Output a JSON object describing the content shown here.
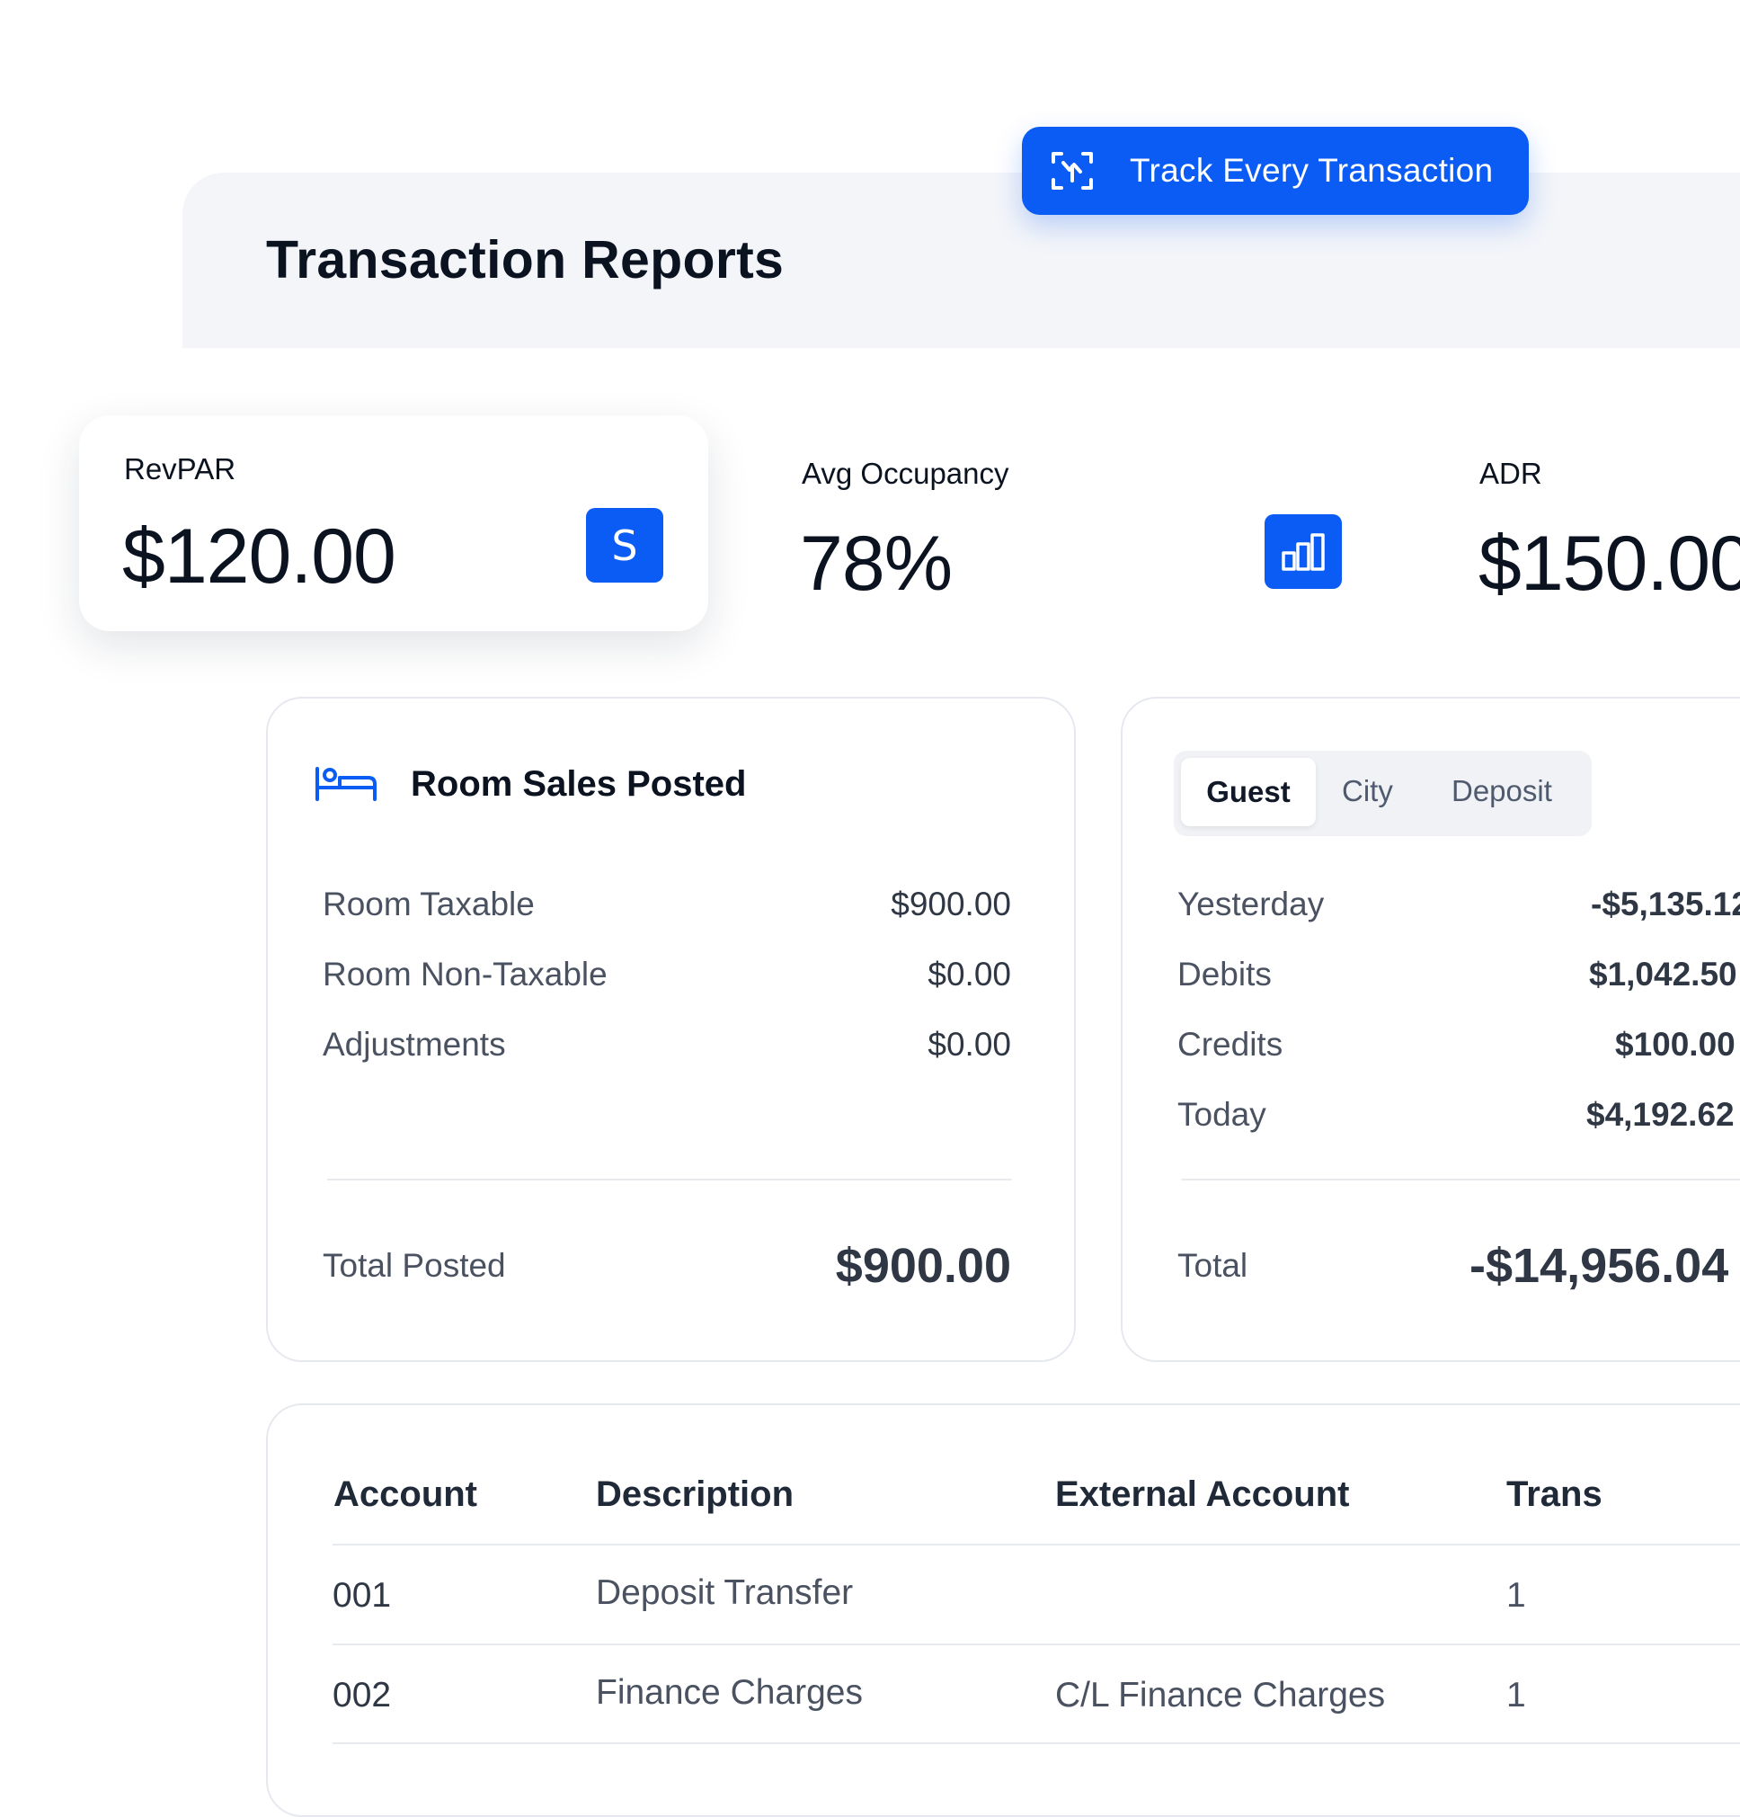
{
  "header": {
    "title": "Transaction Reports",
    "track_button": "Track Every Transaction"
  },
  "kpis": [
    {
      "label": "RevPAR",
      "value": "$120.00",
      "icon": "dollar-s-icon"
    },
    {
      "label": "Avg Occupancy",
      "value": "78%",
      "icon": "bar-chart-icon"
    },
    {
      "label": "ADR",
      "value": "$150.00"
    }
  ],
  "room_sales": {
    "title": "Room Sales Posted",
    "icon": "bed-icon",
    "rows": [
      {
        "label": "Room Taxable",
        "value": "$900.00"
      },
      {
        "label": "Room Non-Taxable",
        "value": "$0.00"
      },
      {
        "label": "Adjustments",
        "value": "$0.00"
      }
    ],
    "total_label": "Total Posted",
    "total_value": "$900.00"
  },
  "ledger": {
    "tabs": [
      "Guest",
      "City",
      "Deposit"
    ],
    "active_tab": "Guest",
    "rows": [
      {
        "label": "Yesterday",
        "value": "-$5,135.12"
      },
      {
        "label": "Debits",
        "value": "$1,042.50"
      },
      {
        "label": "Credits",
        "value": "$100.00"
      },
      {
        "label": "Today",
        "value": "$4,192.62"
      }
    ],
    "total_label": "Total",
    "total_value": "-$14,956.04"
  },
  "table": {
    "columns": [
      "Account",
      "Description",
      "External Account",
      "Trans"
    ],
    "rows": [
      {
        "account": "001",
        "description": "Deposit Transfer",
        "external": "",
        "trans": "1"
      },
      {
        "account": "002",
        "description": "Finance Charges",
        "external": "C/L Finance Charges",
        "trans": "1"
      }
    ]
  },
  "colors": {
    "accent": "#0a5cf5",
    "panel_bg": "#f3f5f9"
  }
}
